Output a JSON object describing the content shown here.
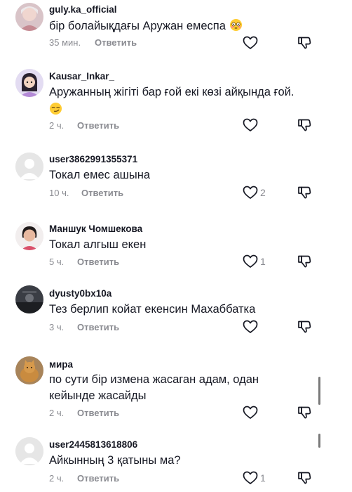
{
  "comments": [
    {
      "username": "guly.ka_official",
      "text": "бір болайықдағы Аружан емеспа",
      "emoji": "flushed-face",
      "time": "35 мин.",
      "reply_label": "Ответить",
      "likes": ""
    },
    {
      "username": "Kausar_Inkar_",
      "text": "Аружанның жігіті бар ғой екі көзі айқында ғой.",
      "emoji": "smirking-face",
      "time": "2 ч.",
      "reply_label": "Ответить",
      "likes": ""
    },
    {
      "username": "user3862991355371",
      "text": "Токал емес ашына",
      "time": "10 ч.",
      "reply_label": "Ответить",
      "likes": "2"
    },
    {
      "username": "Маншук Чомшекова",
      "text": "Токал алгыш екен",
      "time": "5 ч.",
      "reply_label": "Ответить",
      "likes": "1"
    },
    {
      "username": "dyusty0bx10a",
      "text": "Тез берлип койат екенсин Махаббатка",
      "time": "3 ч.",
      "reply_label": "Ответить",
      "likes": ""
    },
    {
      "username": "мира",
      "text": "по сути бір измена жасаган адам, одан кейынде жасайды",
      "time": "2 ч.",
      "reply_label": "Ответить",
      "likes": ""
    },
    {
      "username": "user2445813618806",
      "text": "Айкынның 3 қатыны ма?",
      "time": "2 ч.",
      "reply_label": "Ответить",
      "likes": "1"
    }
  ],
  "icons": {
    "like": "heart-outline-icon",
    "dislike": "thumbs-down-outline-icon"
  },
  "colors": {
    "text": "#161823",
    "secondary": "#8a8b91",
    "background": "#ffffff"
  }
}
